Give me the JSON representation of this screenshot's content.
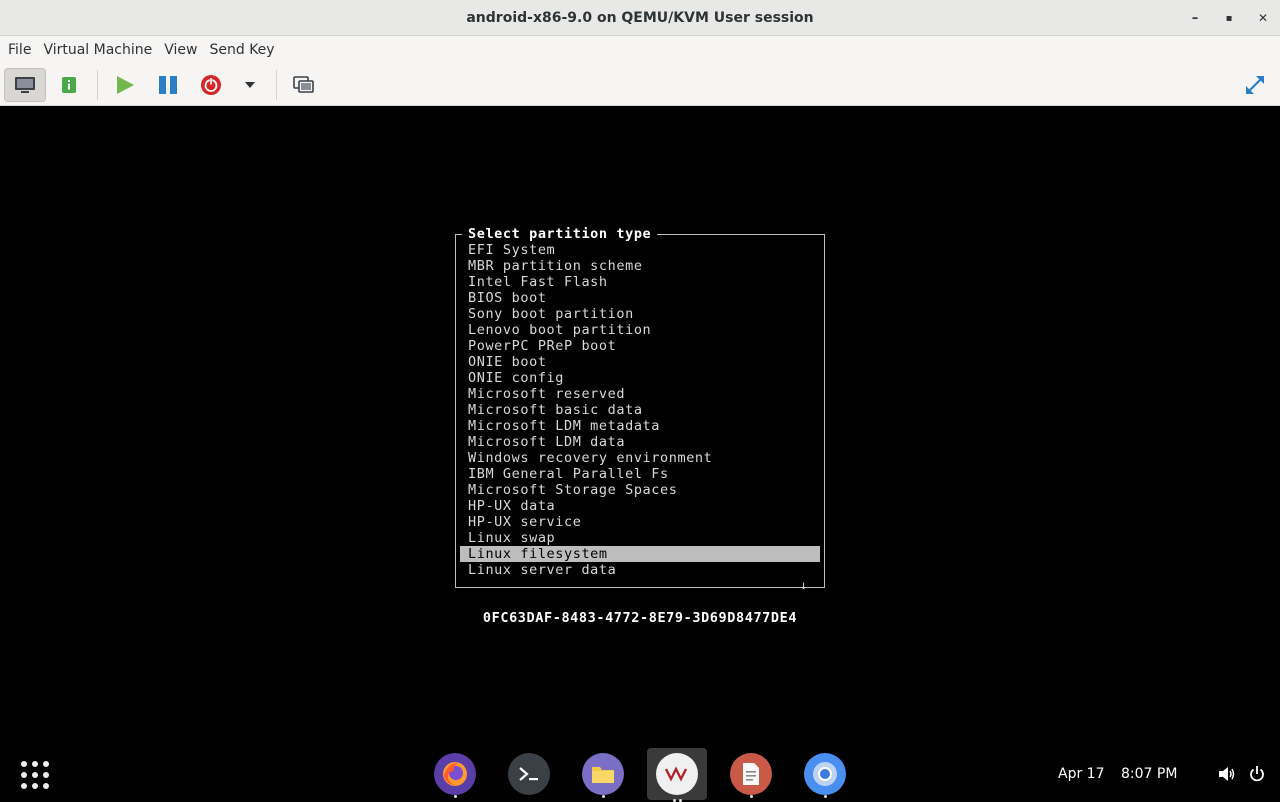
{
  "window": {
    "title": "android-x86-9.0 on QEMU/KVM User session",
    "minimize_glyph": "–",
    "maximize_glyph": "▪",
    "close_glyph": "✕"
  },
  "menubar": {
    "items": [
      "File",
      "Virtual Machine",
      "View",
      "Send Key"
    ]
  },
  "toolbar": {
    "buttons": [
      {
        "name": "console-view",
        "icon": "monitor-icon"
      },
      {
        "name": "details-view",
        "icon": "info-icon",
        "color": "#4aa94a"
      },
      {
        "name": "run",
        "icon": "play-icon",
        "color": "#73b84d"
      },
      {
        "name": "pause",
        "icon": "pause-icon",
        "color": "#2a7fc8"
      },
      {
        "name": "shutdown",
        "icon": "power-icon",
        "color": "#d62828"
      },
      {
        "name": "shutdown-menu",
        "icon": "chevron-down-icon"
      },
      {
        "name": "snapshots",
        "icon": "snapshot-icon"
      },
      {
        "name": "fullscreen",
        "icon": "expand-icon",
        "color": "#2a7fc8"
      }
    ]
  },
  "vm_screen": {
    "dialog_title": "Select partition type",
    "partition_types": [
      "EFI System",
      "MBR partition scheme",
      "Intel Fast Flash",
      "BIOS boot",
      "Sony boot partition",
      "Lenovo boot partition",
      "PowerPC PReP boot",
      "ONIE boot",
      "ONIE config",
      "Microsoft reserved",
      "Microsoft basic data",
      "Microsoft LDM metadata",
      "Microsoft LDM data",
      "Windows recovery environment",
      "IBM General Parallel Fs",
      "Microsoft Storage Spaces",
      "HP-UX data",
      "HP-UX service",
      "Linux swap",
      "Linux filesystem",
      "Linux server data"
    ],
    "selected": "Linux filesystem",
    "scroll_indicator": "↓",
    "type_guid": "0FC63DAF-8483-4772-8E79-3D69D8477DE4"
  },
  "dock": {
    "apps": [
      {
        "name": "firefox",
        "icon": "firefox-icon",
        "color": "#5c3ea8"
      },
      {
        "name": "terminal",
        "icon": "terminal-icon",
        "color": "#3b3f46"
      },
      {
        "name": "files",
        "icon": "folder-icon",
        "color": "#7a6fc4"
      },
      {
        "name": "virt-manager",
        "icon": "virt-manager-icon",
        "color": "#f0f0f0",
        "active": true
      },
      {
        "name": "text-editor",
        "icon": "document-icon",
        "color": "#c95a48"
      },
      {
        "name": "chromium",
        "icon": "chromium-icon",
        "color": "#4a8ef0"
      }
    ],
    "date": "Apr 17",
    "time": "8:07 PM"
  }
}
